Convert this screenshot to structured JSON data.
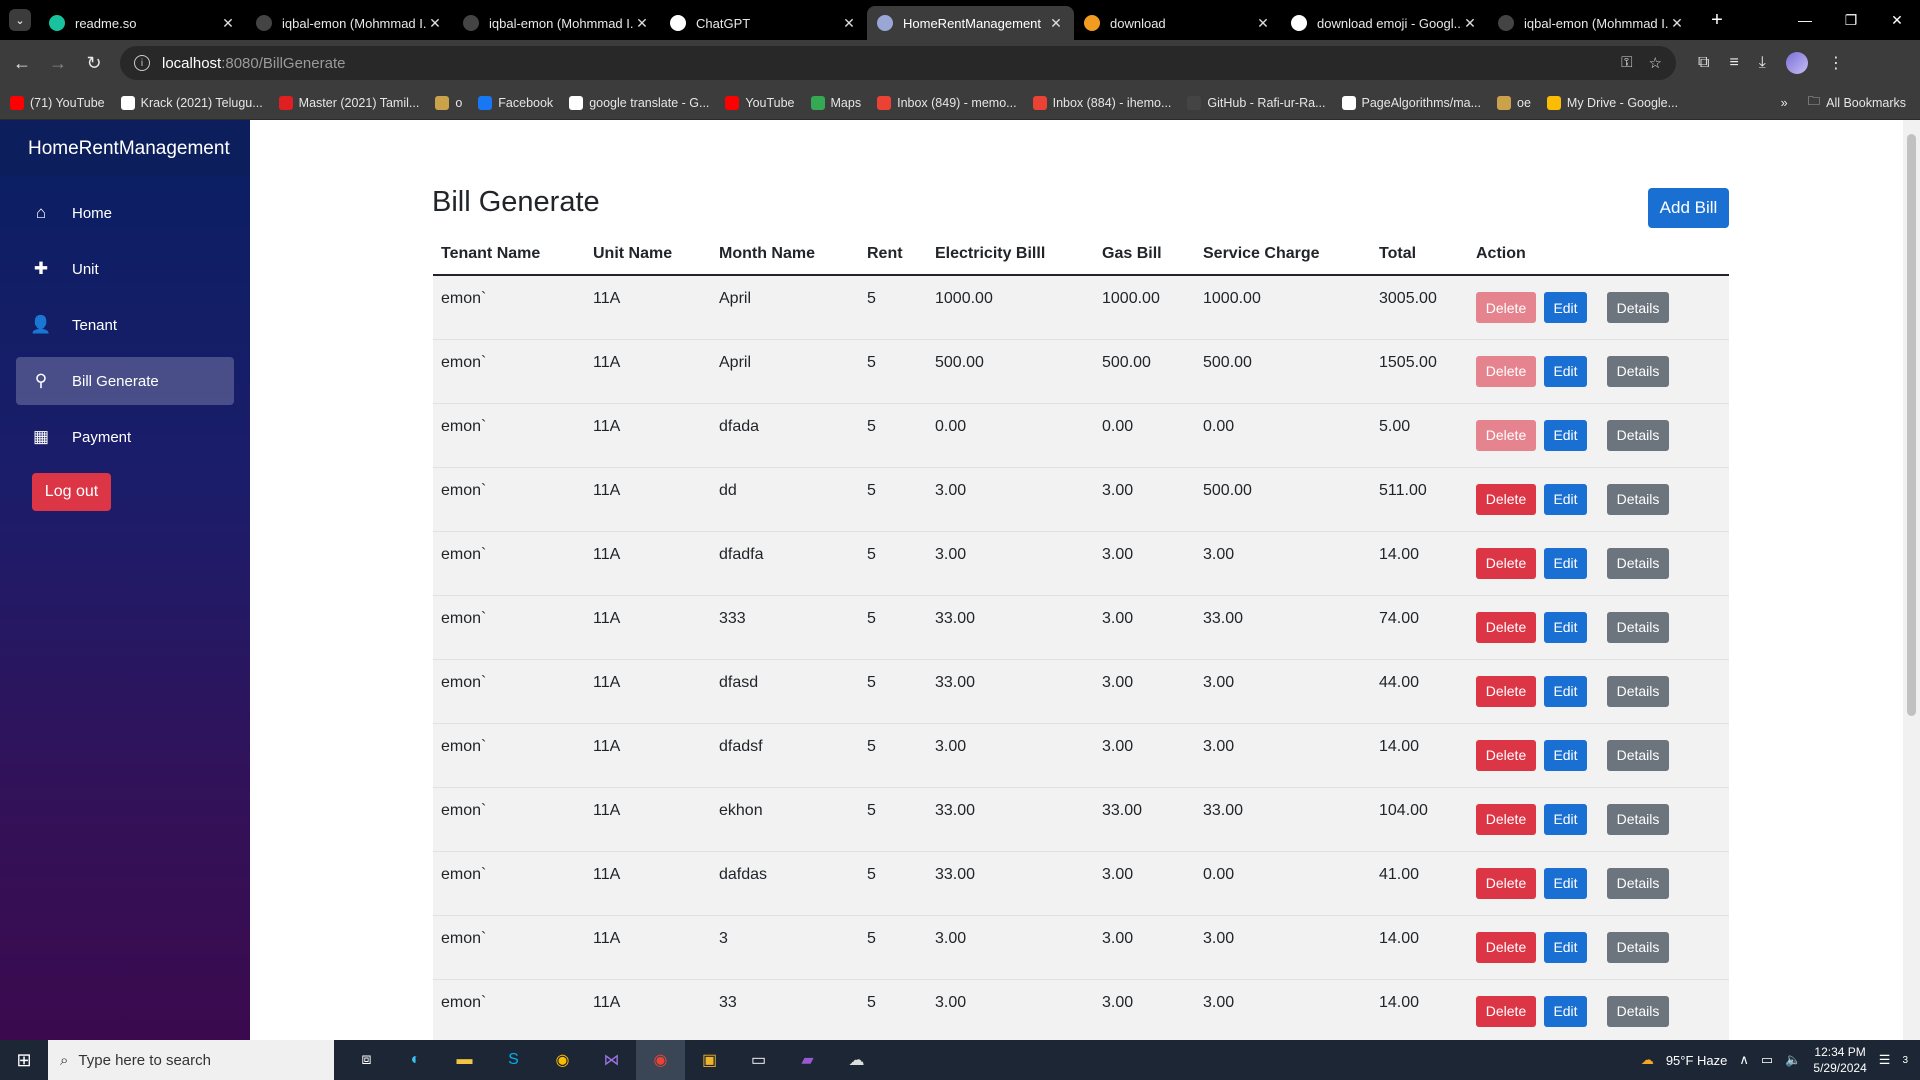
{
  "browser": {
    "tabs": [
      {
        "title": "readme.so",
        "color": "#18c29c",
        "active": false
      },
      {
        "title": "iqbal-emon (Mohmmad I...",
        "color": "#444",
        "active": false
      },
      {
        "title": "iqbal-emon (Mohmmad I...",
        "color": "#444",
        "active": false
      },
      {
        "title": "ChatGPT",
        "color": "#ffffff",
        "active": false
      },
      {
        "title": "HomeRentManagement",
        "color": "#9aa7d6",
        "active": true
      },
      {
        "title": "download",
        "color": "#f29b21",
        "active": false
      },
      {
        "title": "download emoji - Googl...",
        "color": "#ffffff",
        "active": false
      },
      {
        "title": "iqbal-emon (Mohmmad I...",
        "color": "#444",
        "active": false
      }
    ],
    "address": {
      "host": "localhost",
      "path": ":8080/BillGenerate"
    },
    "bookmarks": [
      {
        "label": "(71) YouTube",
        "color": "#ff0000"
      },
      {
        "label": "Krack (2021) Telugu...",
        "color": "#ffffff"
      },
      {
        "label": "Master (2021) Tamil...",
        "color": "#e02020"
      },
      {
        "label": "o",
        "color": "#c9a24a"
      },
      {
        "label": "Facebook",
        "color": "#1877f2"
      },
      {
        "label": "google translate - G...",
        "color": "#ffffff"
      },
      {
        "label": "YouTube",
        "color": "#ff0000"
      },
      {
        "label": "Maps",
        "color": "#34a853"
      },
      {
        "label": "Inbox (849) - memo...",
        "color": "#ea4335"
      },
      {
        "label": "Inbox (884) - ihemo...",
        "color": "#ea4335"
      },
      {
        "label": "GitHub - Rafi-ur-Ra...",
        "color": "#444444"
      },
      {
        "label": "PageAlgorithms/ma...",
        "color": "#ffffff"
      },
      {
        "label": "oe",
        "color": "#c9a24a"
      },
      {
        "label": "My Drive - Google...",
        "color": "#fbbc04"
      }
    ],
    "all_bookmarks": "All Bookmarks"
  },
  "sidebar": {
    "brand": "HomeRentManagement",
    "items": [
      {
        "label": "Home",
        "icon": "home-icon",
        "glyph": "⌂",
        "active": false
      },
      {
        "label": "Unit",
        "icon": "plus-icon",
        "glyph": "✚",
        "active": false
      },
      {
        "label": "Tenant",
        "icon": "user-icon",
        "glyph": "👤",
        "active": false
      },
      {
        "label": "Bill Generate",
        "icon": "bill-icon",
        "glyph": "⚲",
        "active": true
      },
      {
        "label": "Payment",
        "icon": "calendar-icon",
        "glyph": "▦",
        "active": false
      }
    ],
    "logout": "Log out"
  },
  "main": {
    "title": "Bill Generate",
    "add_button": "Add Bill",
    "columns": [
      "Tenant Name",
      "Unit Name",
      "Month Name",
      "Rent",
      "Electricity Billl",
      "Gas Bill",
      "Service Charge",
      "Total",
      "Action"
    ],
    "actions": {
      "delete": "Delete",
      "edit": "Edit",
      "details": "Details"
    },
    "rows": [
      {
        "tenant": "emon`",
        "unit": "11A",
        "month": "April",
        "rent": "5",
        "electricity": "1000.00",
        "gas": "1000.00",
        "service": "1000.00",
        "total": "3005.00",
        "delete_faded": true
      },
      {
        "tenant": "emon`",
        "unit": "11A",
        "month": "April",
        "rent": "5",
        "electricity": "500.00",
        "gas": "500.00",
        "service": "500.00",
        "total": "1505.00",
        "delete_faded": true
      },
      {
        "tenant": "emon`",
        "unit": "11A",
        "month": "dfada",
        "rent": "5",
        "electricity": "0.00",
        "gas": "0.00",
        "service": "0.00",
        "total": "5.00",
        "delete_faded": true
      },
      {
        "tenant": "emon`",
        "unit": "11A",
        "month": "dd",
        "rent": "5",
        "electricity": "3.00",
        "gas": "3.00",
        "service": "500.00",
        "total": "511.00",
        "delete_faded": false
      },
      {
        "tenant": "emon`",
        "unit": "11A",
        "month": "dfadfa",
        "rent": "5",
        "electricity": "3.00",
        "gas": "3.00",
        "service": "3.00",
        "total": "14.00",
        "delete_faded": false
      },
      {
        "tenant": "emon`",
        "unit": "11A",
        "month": "333",
        "rent": "5",
        "electricity": "33.00",
        "gas": "3.00",
        "service": "33.00",
        "total": "74.00",
        "delete_faded": false
      },
      {
        "tenant": "emon`",
        "unit": "11A",
        "month": "dfasd",
        "rent": "5",
        "electricity": "33.00",
        "gas": "3.00",
        "service": "3.00",
        "total": "44.00",
        "delete_faded": false
      },
      {
        "tenant": "emon`",
        "unit": "11A",
        "month": "dfadsf",
        "rent": "5",
        "electricity": "3.00",
        "gas": "3.00",
        "service": "3.00",
        "total": "14.00",
        "delete_faded": false
      },
      {
        "tenant": "emon`",
        "unit": "11A",
        "month": "ekhon",
        "rent": "5",
        "electricity": "33.00",
        "gas": "33.00",
        "service": "33.00",
        "total": "104.00",
        "delete_faded": false
      },
      {
        "tenant": "emon`",
        "unit": "11A",
        "month": "dafdas",
        "rent": "5",
        "electricity": "33.00",
        "gas": "3.00",
        "service": "0.00",
        "total": "41.00",
        "delete_faded": false
      },
      {
        "tenant": "emon`",
        "unit": "11A",
        "month": "3",
        "rent": "5",
        "electricity": "3.00",
        "gas": "3.00",
        "service": "3.00",
        "total": "14.00",
        "delete_faded": false
      },
      {
        "tenant": "emon`",
        "unit": "11A",
        "month": "33",
        "rent": "5",
        "electricity": "3.00",
        "gas": "3.00",
        "service": "3.00",
        "total": "14.00",
        "delete_faded": false
      }
    ]
  },
  "taskbar": {
    "search_placeholder": "Type here to search",
    "weather": "95°F  Haze",
    "time": "12:34 PM",
    "date": "5/29/2024",
    "notification_count": "3"
  }
}
